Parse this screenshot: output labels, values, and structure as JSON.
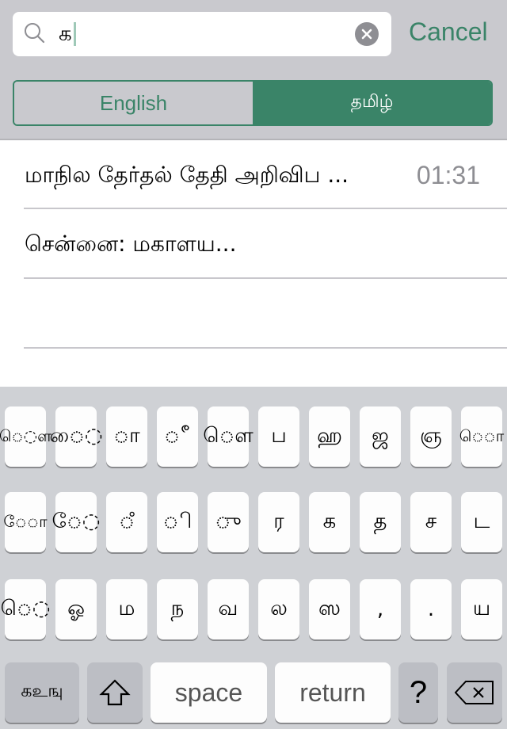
{
  "search": {
    "value": "க",
    "icon": "search-icon",
    "clear_icon": "clear-icon",
    "cancel_label": "Cancel"
  },
  "language_toggle": {
    "options": [
      {
        "label": "English",
        "selected": false
      },
      {
        "label": "தமிழ்",
        "selected": true
      }
    ]
  },
  "results": [
    {
      "title": "மாநில தேர்தல் தேதி அறிவிப ...",
      "time": "01:31"
    },
    {
      "title": "சென்னை: மகாளய...",
      "time": ""
    }
  ],
  "keyboard": {
    "rows": [
      [
        "ெ◌ள",
        "ை◌",
        "◌ா",
        "◌ீ",
        "◌ௌ",
        "ப",
        "ஹ",
        "ஜ",
        "ஞ",
        "ெ◌ா"
      ],
      [
        "ே◌ா",
        "ே◌",
        "◌ஂ",
        "◌ி",
        "◌ு",
        "ர",
        "க",
        "த",
        "ச",
        "ட"
      ],
      [
        "ெ◌",
        "ஓ",
        "ம",
        "ந",
        "வ",
        "ல",
        "ஸ",
        ",",
        ".",
        "ய"
      ]
    ],
    "bottom_row": {
      "layout_switch_label": "கஉஙு",
      "shift_icon": "shift-icon",
      "space_label": "space",
      "return_label": "return",
      "question_label": "?",
      "delete_icon": "delete-icon"
    }
  },
  "colors": {
    "accent": "#3a8468",
    "header_bg": "#c9c9ce",
    "keyboard_bg": "#cfd1d5"
  }
}
